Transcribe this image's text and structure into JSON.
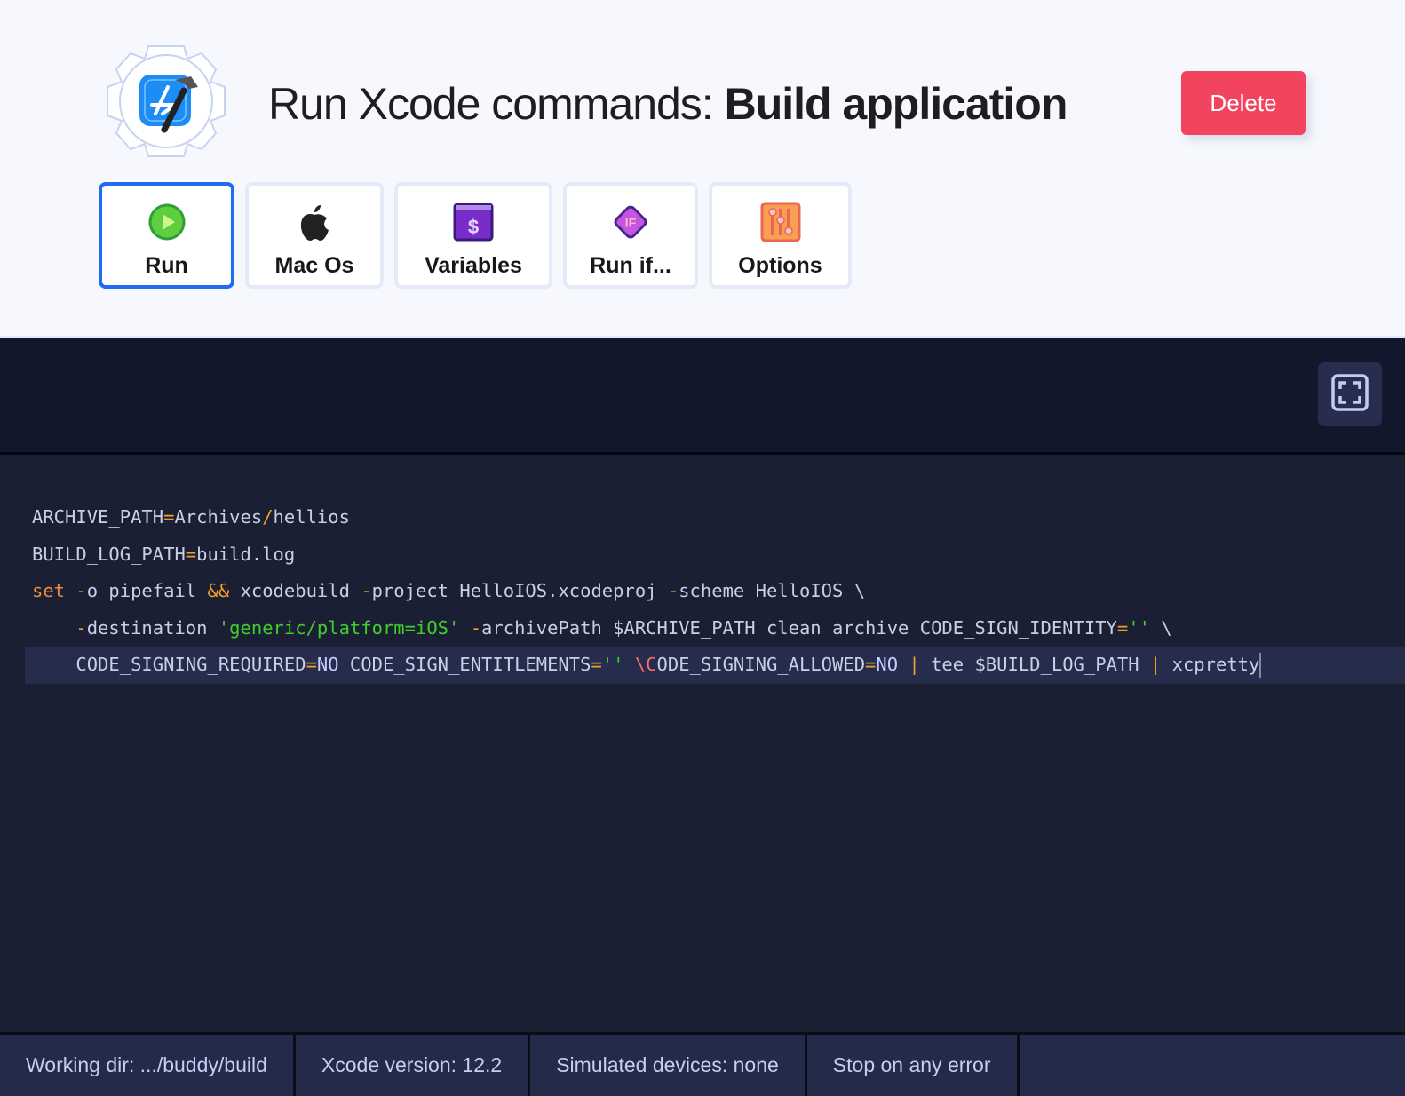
{
  "header": {
    "title_prefix": "Run Xcode commands: ",
    "title_bold": "Build application",
    "delete_label": "Delete",
    "logo_icon": "xcode-gear-icon"
  },
  "tabs": [
    {
      "label": "Run",
      "icon": "play-circle-icon",
      "active": true
    },
    {
      "label": "Mac Os",
      "icon": "apple-icon",
      "active": false
    },
    {
      "label": "Variables",
      "icon": "dollar-window-icon",
      "active": false
    },
    {
      "label": "Run if...",
      "icon": "if-diamond-icon",
      "active": false
    },
    {
      "label": "Options",
      "icon": "sliders-icon",
      "active": false
    }
  ],
  "editor": {
    "fullscreen_icon": "fullscreen-icon",
    "lines": [
      "ARCHIVE_PATH=Archives/hellios",
      "BUILD_LOG_PATH=build.log",
      "set -o pipefail && xcodebuild -project HelloIOS.xcodeproj -scheme HelloIOS \\",
      "    -destination 'generic/platform=iOS' -archivePath $ARCHIVE_PATH clean archive CODE_SIGN_IDENTITY='' \\",
      "    CODE_SIGNING_REQUIRED=NO CODE_SIGN_ENTITLEMENTS='' \\CODE_SIGNING_ALLOWED=NO | tee $BUILD_LOG_PATH | xcpretty"
    ],
    "active_line": 5
  },
  "statusbar": [
    "Working dir: .../buddy/build",
    "Xcode version: 12.2",
    "Simulated devices: none",
    "Stop on any error"
  ],
  "colors": {
    "accent": "#1e6cf0",
    "delete": "#f2445f",
    "editor_bg": "#1b1f34",
    "status_bg": "#242a49"
  }
}
